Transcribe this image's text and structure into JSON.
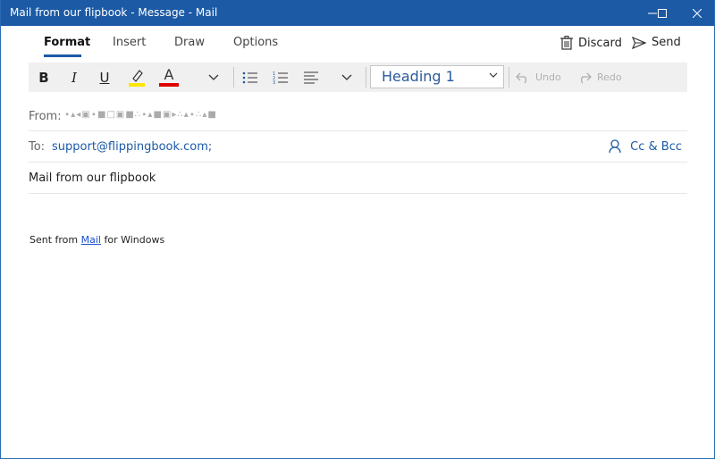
{
  "window": {
    "title": "Mail from our flipbook - Message - Mail",
    "controls": [
      "minimize-icon",
      "maximize-icon",
      "close-icon"
    ]
  },
  "tabs": [
    {
      "label": "Format",
      "active": true
    },
    {
      "label": "Insert",
      "active": false
    },
    {
      "label": "Draw",
      "active": false
    },
    {
      "label": "Options",
      "active": false
    }
  ],
  "actions": {
    "discard_label": "Discard",
    "send_label": "Send"
  },
  "toolbar": {
    "bold": "B",
    "italic": "I",
    "underline": "U",
    "font_color_glyph": "A",
    "highlight_color": "#ffe600",
    "font_color": "#e00000",
    "style_value": "Heading 1",
    "undo_label": "Undo",
    "redo_label": "Redo"
  },
  "from": {
    "label": "From:",
    "value": "∙▴◂▣∙■□▣■∴∙▴■▣▸∴▴∙∴▴■"
  },
  "to": {
    "label": "To:",
    "value": "support@flippingbook.com;",
    "cc_bcc_label": "Cc & Bcc"
  },
  "subject": "Mail from our flipbook",
  "body": {
    "prefix": "Sent from ",
    "link": "Mail",
    "suffix": " for Windows"
  }
}
